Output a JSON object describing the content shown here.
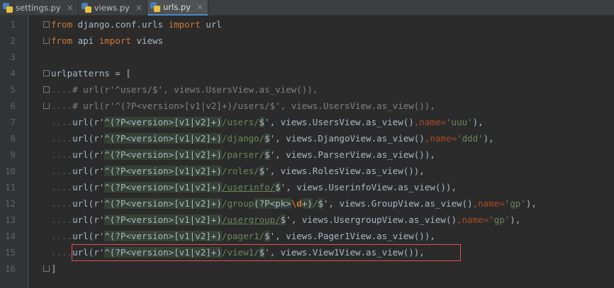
{
  "tabs": [
    {
      "label": "settings.py",
      "active": false
    },
    {
      "label": "views.py",
      "active": false
    },
    {
      "label": "urls.py",
      "active": true
    }
  ],
  "lines": [
    {
      "n": "1",
      "parts": [
        [
          "kw",
          "from"
        ],
        [
          "p",
          " django.conf.urls "
        ],
        [
          "kw",
          "import"
        ],
        [
          "p",
          " url"
        ]
      ]
    },
    {
      "n": "2",
      "parts": [
        [
          "kw",
          "from"
        ],
        [
          "p",
          " api "
        ],
        [
          "kw",
          "import"
        ],
        [
          "p",
          " views"
        ]
      ]
    },
    {
      "n": "3",
      "parts": []
    },
    {
      "n": "4",
      "parts": [
        [
          "p",
          "urlpatterns = ["
        ]
      ]
    },
    {
      "n": "5",
      "parts": [
        [
          "dots",
          "...."
        ],
        [
          "cm",
          "# url(r'^users/$', views.UsersView.as_view()),"
        ]
      ]
    },
    {
      "n": "6",
      "parts": [
        [
          "dots",
          "...."
        ],
        [
          "cm",
          "# url(r'^(?P<version>[v1|v2]+)/users/$', views.UsersView.as_view()),"
        ]
      ]
    },
    {
      "n": "7",
      "parts": [
        [
          "dots",
          "...."
        ],
        [
          "p",
          "url(r'"
        ],
        [
          "rx",
          "^(?P<version>[v1|v2]+)"
        ],
        [
          "st",
          "/users/"
        ],
        [
          "rx",
          "$"
        ],
        [
          "p",
          "', views.UsersView.as_view()"
        ],
        [
          "kwarg",
          ",name="
        ],
        [
          "st",
          "'uuu'"
        ],
        [
          "p",
          "),"
        ]
      ]
    },
    {
      "n": "8",
      "parts": [
        [
          "dots",
          "...."
        ],
        [
          "p",
          "url(r'"
        ],
        [
          "rx",
          "^(?P<version>[v1|v2]+)"
        ],
        [
          "st",
          "/django/"
        ],
        [
          "rx",
          "$"
        ],
        [
          "p",
          "', views.DjangoView.as_view()"
        ],
        [
          "kwarg",
          ",name="
        ],
        [
          "st",
          "'ddd'"
        ],
        [
          "p",
          "),"
        ]
      ]
    },
    {
      "n": "9",
      "parts": [
        [
          "dots",
          "...."
        ],
        [
          "p",
          "url(r'"
        ],
        [
          "rx",
          "^(?P<version>[v1|v2]+)"
        ],
        [
          "st",
          "/parser/"
        ],
        [
          "rx",
          "$"
        ],
        [
          "p",
          "', views.ParserView.as_view()),"
        ]
      ]
    },
    {
      "n": "10",
      "parts": [
        [
          "dots",
          "...."
        ],
        [
          "p",
          "url(r'"
        ],
        [
          "rx",
          "^(?P<version>[v1|v2]+)"
        ],
        [
          "st",
          "/roles/"
        ],
        [
          "rx",
          "$"
        ],
        [
          "p",
          "', views.RolesView.as_view()),"
        ]
      ]
    },
    {
      "n": "11",
      "parts": [
        [
          "dots",
          "...."
        ],
        [
          "p",
          "url(r'"
        ],
        [
          "rx",
          "^(?P<version>[v1|v2]+)"
        ],
        [
          "stu",
          "/userinfo/"
        ],
        [
          "rx",
          "$"
        ],
        [
          "p",
          "', views.UserinfoView.as_view()),"
        ]
      ]
    },
    {
      "n": "12",
      "parts": [
        [
          "dots",
          "...."
        ],
        [
          "p",
          "url(r'"
        ],
        [
          "rx",
          "^(?P<version>[v1|v2]+)"
        ],
        [
          "st",
          "/group"
        ],
        [
          "rx",
          "(?P<pk>"
        ],
        [
          "bold",
          "\\d"
        ],
        [
          "rx",
          "+)"
        ],
        [
          "st",
          "/"
        ],
        [
          "rx",
          "$"
        ],
        [
          "p",
          "', views.GroupView.as_view()"
        ],
        [
          "kwarg",
          ",name="
        ],
        [
          "st",
          "'gp'"
        ],
        [
          "p",
          "),"
        ]
      ]
    },
    {
      "n": "13",
      "parts": [
        [
          "dots",
          "...."
        ],
        [
          "p",
          "url(r'"
        ],
        [
          "rx",
          "^(?P<version>[v1|v2]+)"
        ],
        [
          "stu",
          "/usergroup/"
        ],
        [
          "rx",
          "$"
        ],
        [
          "p",
          "', views.UsergroupView.as_view()"
        ],
        [
          "kwarg",
          ",name="
        ],
        [
          "st",
          "'gp'"
        ],
        [
          "p",
          "),"
        ]
      ]
    },
    {
      "n": "14",
      "parts": [
        [
          "dots",
          "...."
        ],
        [
          "p",
          "url(r'"
        ],
        [
          "rx",
          "^(?P<version>[v1|v2]+)"
        ],
        [
          "st",
          "/pager1/"
        ],
        [
          "rx",
          "$"
        ],
        [
          "p",
          "', views.Pager1View.as_view()),"
        ]
      ]
    },
    {
      "n": "15",
      "parts": [
        [
          "dots",
          "...."
        ],
        [
          "p",
          "url(r'"
        ],
        [
          "rx",
          "^(?P<version>[v1|v2]+)"
        ],
        [
          "st",
          "/view1/"
        ],
        [
          "rx",
          "$"
        ],
        [
          "p",
          "', views.View1View.as_view()),"
        ]
      ]
    },
    {
      "n": "16",
      "parts": [
        [
          "p",
          "]"
        ]
      ]
    }
  ],
  "colors": {
    "highlight_box": "#e05050",
    "keyword": "#cc7832",
    "string": "#6a8759",
    "comment": "#808080"
  }
}
